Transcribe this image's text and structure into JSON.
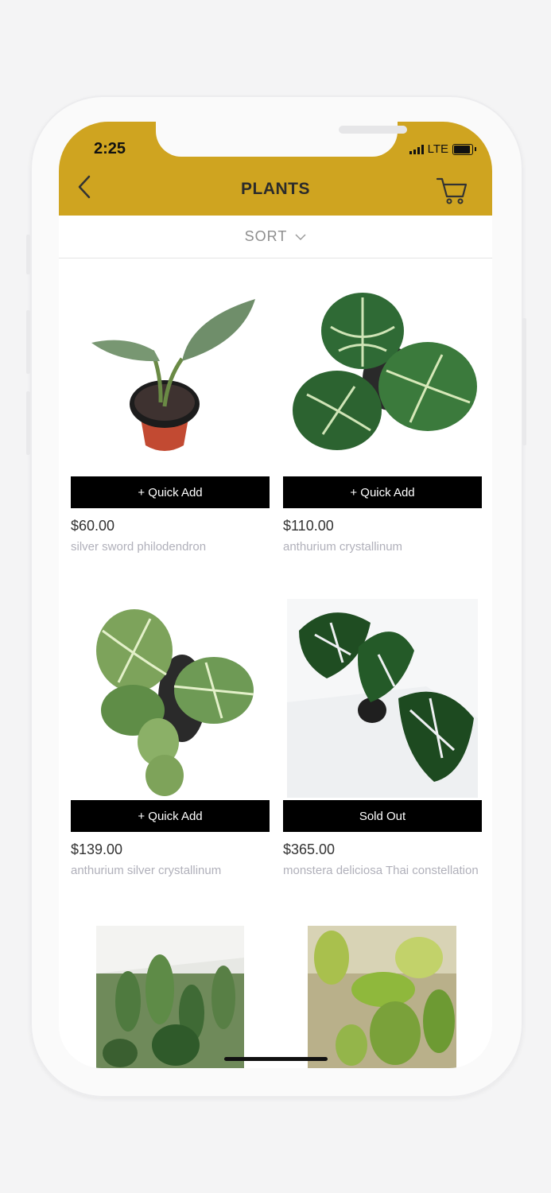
{
  "status_bar": {
    "time": "2:25",
    "network": "LTE"
  },
  "nav": {
    "title": "PLANTS"
  },
  "sort": {
    "label": "SORT"
  },
  "products": [
    {
      "price": "$60.00",
      "name": "silver sword philodendron",
      "action": "+ Quick Add"
    },
    {
      "price": "$110.00",
      "name": "anthurium crystallinum",
      "action": "+ Quick Add"
    },
    {
      "price": "$139.00",
      "name": "anthurium silver crystallinum",
      "action": "+ Quick Add"
    },
    {
      "price": "$365.00",
      "name": "monstera deliciosa Thai constellation",
      "action": "Sold Out"
    }
  ],
  "colors": {
    "header": "#cfa420",
    "button": "#000000",
    "price": "#333333",
    "name": "#b0b0ba"
  }
}
